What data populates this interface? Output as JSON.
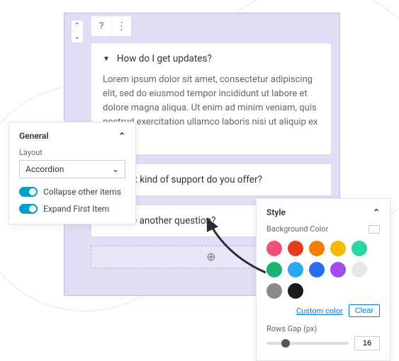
{
  "accordion": {
    "items": [
      {
        "question": "How do I get updates?",
        "answer": "Lorem ipsum dolor sit amet, consectetur adipiscing elit, sed do eiusmod tempor incididunt ut labore et dolore magna aliqua. Ut enim ad minim veniam, quis nostrud exercitation ullamco laboris nisi ut aliquip ex ea",
        "expanded": true
      },
      {
        "question": "What kind of support do you offer?",
        "expanded": false
      },
      {
        "question": "Have another question?",
        "expanded": false
      }
    ]
  },
  "general_panel": {
    "title": "General",
    "layout_label": "Layout",
    "layout_value": "Accordion",
    "toggles": {
      "collapse_label": "Collapse other items",
      "expand_label": "Expand First Item"
    }
  },
  "style_panel": {
    "title": "Style",
    "bg_label": "Background Color",
    "colors": [
      "#f44e7a",
      "#e63b1f",
      "#f57c00",
      "#f9b700",
      "#2bd6a0",
      "#1ab36f",
      "#2aa8f2",
      "#2a6df2",
      "#a24bf2",
      "#e8e8e8",
      "#8a8a8a",
      "#1a1a1a"
    ],
    "custom_label": "Custom color",
    "clear_label": "Clear",
    "rows_gap_label": "Rows Gap (px)",
    "rows_gap_value": "16"
  }
}
